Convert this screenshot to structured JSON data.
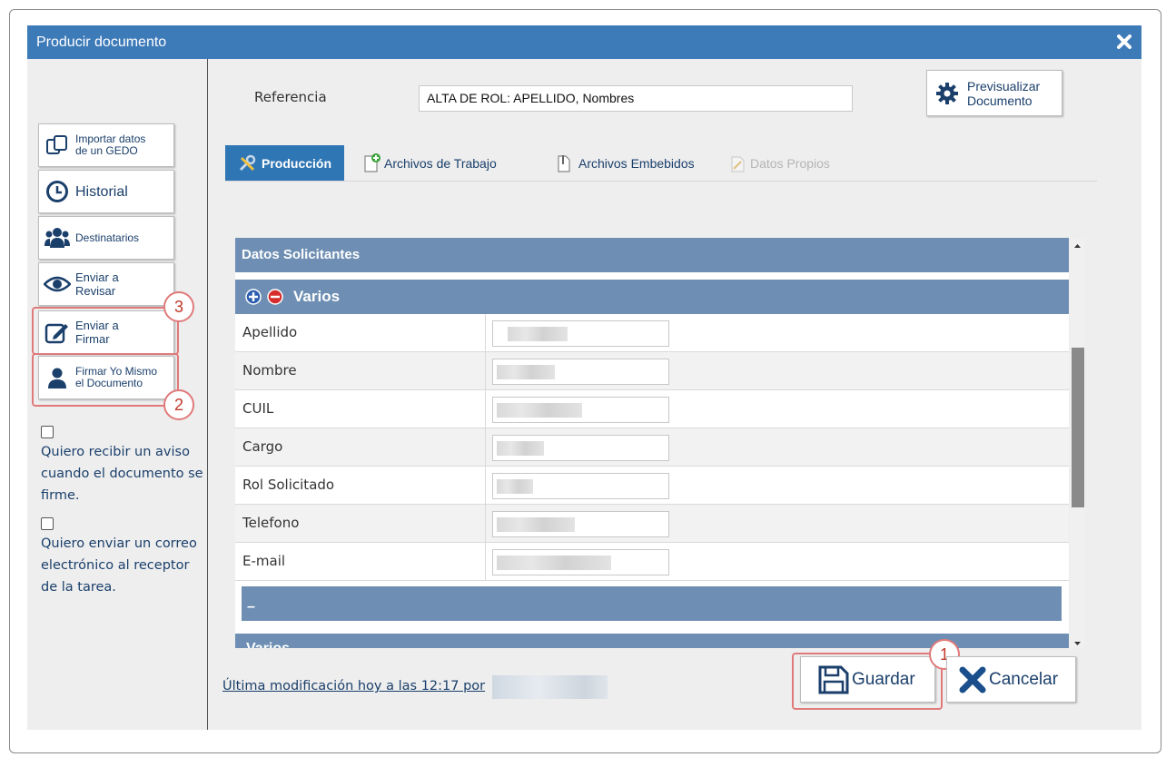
{
  "dialog": {
    "title": "Producir documento"
  },
  "sidebar": {
    "buttons": [
      {
        "line1": "Importar datos",
        "line2": "de un GEDO",
        "icon": "copy-icon"
      },
      {
        "line1": "Historial",
        "icon": "clock-icon"
      },
      {
        "line1": "Destinatarios",
        "icon": "users-icon"
      },
      {
        "line1": "Enviar a",
        "line2": "Revisar",
        "icon": "eye-icon"
      },
      {
        "line1": "Enviar a",
        "line2": "Firmar",
        "icon": "edit-icon"
      },
      {
        "line1": "Firmar Yo Mismo",
        "line2": "el Documento",
        "icon": "user-icon"
      }
    ],
    "checkbox1": "Quiero recibir un aviso cuando el documento se firme.",
    "checkbox2": "Quiero enviar un correo electrónico al receptor de la tarea."
  },
  "reference": {
    "label": "Referencia",
    "value": "ALTA DE ROL: APELLIDO, Nombres"
  },
  "preview": {
    "line1": "Previsualizar",
    "line2": "Documento"
  },
  "tabs": [
    {
      "label": "Producción",
      "state": "active"
    },
    {
      "label": "Archivos de Trabajo",
      "state": "normal"
    },
    {
      "label": "Archivos Embebidos",
      "state": "normal"
    },
    {
      "label": "Datos Propios",
      "state": "disabled"
    }
  ],
  "form": {
    "section_title": "Datos Solicitantes",
    "group_title": "Varios",
    "fields": [
      {
        "label": "Apellido"
      },
      {
        "label": "Nombre"
      },
      {
        "label": "CUIL"
      },
      {
        "label": "Cargo"
      },
      {
        "label": "Rol Solicitado"
      },
      {
        "label": "Telefono"
      },
      {
        "label": "E-mail"
      }
    ],
    "collapsed_bar": "–",
    "next_group_title": "Varios"
  },
  "footer": {
    "last_modified": "Última modificación hoy a las 12:17 por",
    "save": "Guardar",
    "cancel": "Cancelar"
  },
  "annotations": {
    "badge1": "1",
    "badge2": "2",
    "badge3": "3"
  },
  "colors": {
    "titlebar": "#3d7ab8",
    "section": "#6e8fb3",
    "accent_text": "#1a3f6b",
    "highlight": "#e07a7a"
  }
}
